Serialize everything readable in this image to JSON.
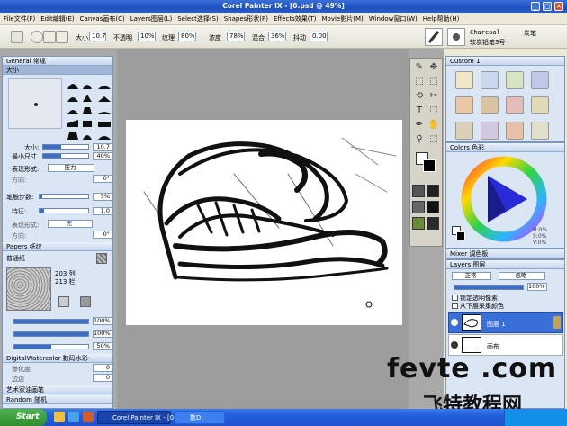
{
  "window": {
    "title": "Corel Painter IX - [0.psd @ 49%]",
    "min": "_",
    "max": "□",
    "close": "×"
  },
  "menubar": {
    "items": [
      "File文件(F)",
      "Edit编辑(E)",
      "Canvas画布(C)",
      "Layers图层(L)",
      "Select选择(S)",
      "Shapes形状(P)",
      "Effects效果(T)",
      "Movie影片(M)",
      "Window窗口(W)",
      "Help帮助(H)"
    ]
  },
  "propbar": {
    "size_label": "大小",
    "size_value": "10.7",
    "opacity_label": "不透明",
    "opacity_value": "10%",
    "grain_label": "纹理",
    "grain_value": "80%",
    "resat_label": "浓度",
    "resat_value": "78%",
    "bleed_label": "混合",
    "bleed_value": "36%",
    "jitter_label": "抖动",
    "jitter_value": "0.00",
    "brush_category": "Charcoal",
    "brush_category_cn": "炭笔",
    "brush_variant": "软炭铅笔3号"
  },
  "left_panel": {
    "general_title": "General 常规",
    "size_section": "大小",
    "size_label": "大小:",
    "size_value": "10.7",
    "minsize_label": "最小尺寸",
    "minsize_value": "40%",
    "expression_label": "表现形式:",
    "expression_value": "压力",
    "direction_label": "方向:",
    "direction_value": "0°",
    "steps_label": "笔触步数:",
    "steps_value": "5%",
    "feature_label": "特征:",
    "feature_value": "1.0",
    "expression2_label": "表现形式:",
    "expression2_value": "无",
    "direction2_label": "方向:",
    "direction2_value": "0°",
    "papers_title": "Papers 纸纹",
    "paper_name": "普通纸",
    "paper_cols": "203 列",
    "paper_rows": "213 栏",
    "paper_scale": "100%",
    "paper_contrast": "100%",
    "paper_brightness": "50%",
    "digitalwc_title": "DigitalWatercolor 数码水彩",
    "wet_label": "渗化度",
    "wet_value": "0",
    "edge_label": "边边",
    "edge_value": "0",
    "artoil_title": "艺术家油画笔",
    "random_title": "Random 随机"
  },
  "toolbox": {
    "tools": [
      "✎",
      "✥",
      "⬚",
      "⬚",
      "⟲",
      "✂",
      "T",
      "⬚",
      "✒",
      "✋",
      "⚲",
      "⬚"
    ]
  },
  "right_panel": {
    "custom_title": "Custom 1",
    "colors_title": "Colors 色彩",
    "color_readout": [
      "H:0%",
      "S:0%",
      "V:0%"
    ],
    "mixer_title": "Mixer 调色板",
    "layers_title": "Layers 图层",
    "composite_method": "正常",
    "composite_depth": "忽略",
    "layer_opacity": "100%",
    "preserve_label": "锁定透明像素",
    "pick_label": "从下层采集颜色",
    "layers": [
      {
        "name": "图层 1",
        "selected": true
      },
      {
        "name": "画布",
        "selected": false
      }
    ]
  },
  "taskbar": {
    "start": "Start",
    "tasks": [
      "Corel Painter IX - [0....",
      "数D:"
    ]
  },
  "watermark": {
    "line1": "fevte .com",
    "line2": "飞特教程网"
  },
  "colors": {
    "accent": "#3b6dc4",
    "selected_layer": "#3a6fd8"
  }
}
